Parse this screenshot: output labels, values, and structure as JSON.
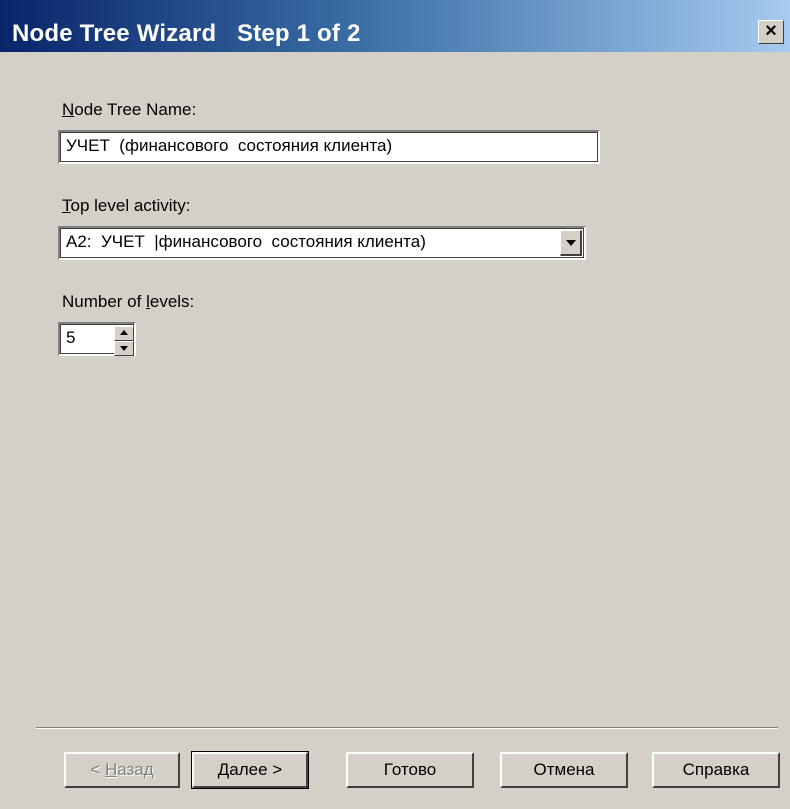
{
  "window": {
    "title": "Node Tree Wizard   Step 1 of 2",
    "close_label": "×"
  },
  "form": {
    "name_label_accel": "N",
    "name_label_rest": "ode Tree Name:",
    "name_value": "УЧЕТ  (финансового  состояния клиента)",
    "activity_label_accel": "T",
    "activity_label_rest": "op level activity:",
    "activity_value": "A2:  УЧЕТ  |финансового  состояния клиента)",
    "levels_label_pre": "Number of ",
    "levels_label_accel": "l",
    "levels_label_rest": "evels:",
    "levels_value": "5"
  },
  "buttons": {
    "back_arrow": "< ",
    "back_accel": "Н",
    "back_rest": "азад",
    "next_accel": "Д",
    "next_rest": "алее >",
    "finish": "Готово",
    "cancel": "Отмена",
    "help": "Справка"
  },
  "colors": {
    "dialog_bg": "#d4d0c8",
    "title_gradient_start": "#0a246a",
    "title_gradient_end": "#a6caf0"
  }
}
